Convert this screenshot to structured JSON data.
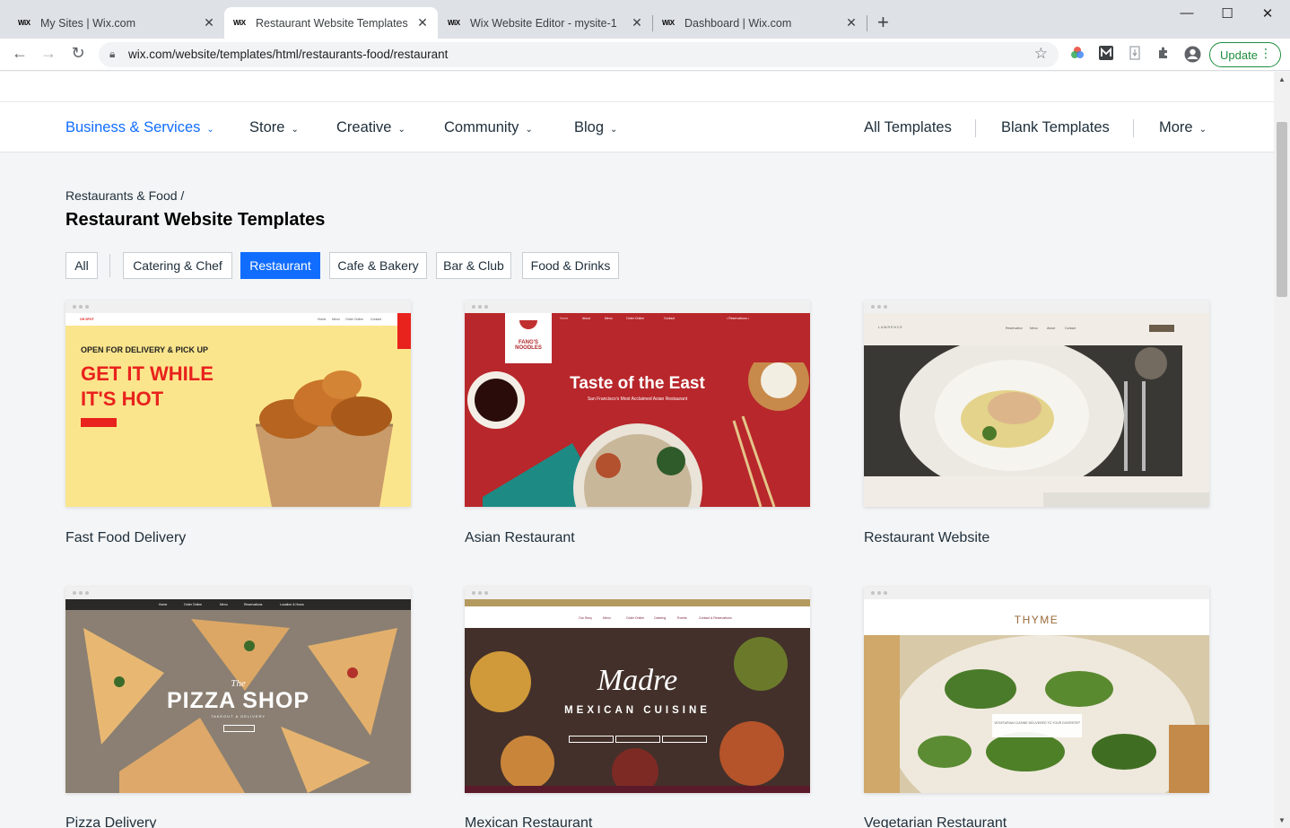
{
  "browser": {
    "tabs": [
      {
        "favicon": "WiX",
        "title": "My Sites | Wix.com"
      },
      {
        "favicon": "WiX",
        "title": "Restaurant Website Templates | R"
      },
      {
        "favicon": "WiX",
        "title": "Wix Website Editor - mysite-1"
      },
      {
        "favicon": "WiX",
        "title": "Dashboard | Wix.com"
      }
    ],
    "url": "wix.com/website/templates/html/restaurants-food/restaurant",
    "update_label": "Update"
  },
  "nav": {
    "items": [
      "Business & Services",
      "Store",
      "Creative",
      "Community",
      "Blog"
    ],
    "right": [
      "All Templates",
      "Blank Templates",
      "More"
    ]
  },
  "page": {
    "breadcrumb": "Restaurants & Food /",
    "title": "Restaurant Website Templates",
    "filters": [
      "All",
      "Catering & Chef",
      "Restaurant",
      "Cafe & Bakery",
      "Bar & Club",
      "Food & Drinks"
    ],
    "selected_filter": "Restaurant"
  },
  "templates": [
    {
      "name": "Fast Food Delivery",
      "hero_kicker": "OPEN FOR DELIVERY & PICK UP",
      "hero_line1": "GET IT WHILE",
      "hero_line2": "IT'S HOT",
      "brand": "OH SPOT",
      "nav_links": [
        "Home",
        "Menu",
        "Order Online",
        "Contact"
      ]
    },
    {
      "name": "Asian Restaurant",
      "hero": "Taste of the East",
      "sub": "San Francisco's Most Acclaimed Asian Restaurant",
      "logo": "FANG'S NOODLES",
      "nav_links": [
        "Home",
        "About",
        "Menu",
        "Order Online",
        "Contact"
      ],
      "cta": "• Reservations •"
    },
    {
      "name": "Restaurant Website",
      "brand": "LAWRENCE",
      "nav_links": [
        "Reservation",
        "Menu",
        "About",
        "Contact"
      ]
    },
    {
      "name": "Pizza Delivery",
      "hero_pre": "The",
      "hero": "PIZZA SHOP",
      "sub": "TAKEOUT & DELIVERY",
      "nav_links": [
        "Home",
        "Order Online",
        "Menu",
        "Reservations",
        "Location & Hours"
      ]
    },
    {
      "name": "Mexican Restaurant",
      "hero": "Madre",
      "sub": "MEXICAN CUISINE",
      "nav_links": [
        "Our Story",
        "Menu",
        "Order Online",
        "Catering",
        "Events",
        "Contact & Reservations"
      ]
    },
    {
      "name": "Vegetarian Restaurant",
      "hero": "THYME",
      "sub": "VEGETARIAN CUISINE DELIVERED TO YOUR DOORSTEP"
    }
  ]
}
